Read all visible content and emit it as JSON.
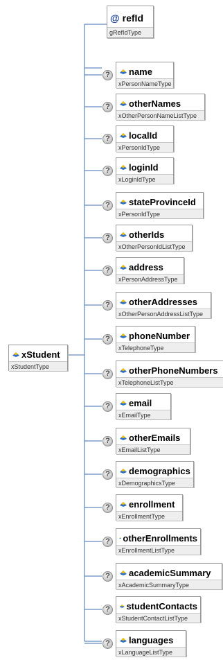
{
  "root": {
    "name": "xStudent",
    "type": "xStudentType"
  },
  "attribute": {
    "name": "refId",
    "type": "gRefIdType",
    "symbol": "@"
  },
  "optional_marker": "?",
  "children": [
    {
      "name": "name",
      "type": "xPersonNameType"
    },
    {
      "name": "otherNames",
      "type": "xOtherPersonNameListType"
    },
    {
      "name": "localId",
      "type": "xPersonIdType"
    },
    {
      "name": "loginId",
      "type": "xLoginIdType"
    },
    {
      "name": "stateProvinceId",
      "type": "xPersonIdType"
    },
    {
      "name": "otherIds",
      "type": "xOtherPersonIdListType"
    },
    {
      "name": "address",
      "type": "xPersonAddressType"
    },
    {
      "name": "otherAddresses",
      "type": "xOtherPersonAddressListType"
    },
    {
      "name": "phoneNumber",
      "type": "xTelephoneType"
    },
    {
      "name": "otherPhoneNumbers",
      "type": "xTelephoneListType"
    },
    {
      "name": "email",
      "type": "xEmailType"
    },
    {
      "name": "otherEmails",
      "type": "xEmailListType"
    },
    {
      "name": "demographics",
      "type": "xDemographicsType"
    },
    {
      "name": "enrollment",
      "type": "xEnrollmentType"
    },
    {
      "name": "otherEnrollments",
      "type": "xEnrollmentListType"
    },
    {
      "name": "academicSummary",
      "type": "xAcademicSummaryType"
    },
    {
      "name": "studentContacts",
      "type": "xStudentContactListType"
    },
    {
      "name": "languages",
      "type": "xLanguageListType"
    }
  ],
  "colors": {
    "line": "#3c6eb4",
    "border": "#9a9a9a",
    "type_bg": "#eeeeee",
    "icon_blue": "#2e6fc9",
    "icon_yellow": "#f2c200"
  }
}
